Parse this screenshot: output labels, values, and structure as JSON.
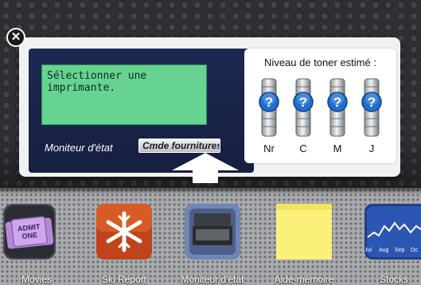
{
  "widget": {
    "lcd_text": "Sélectionner une\nimprimante.",
    "status_label": "Moniteur d'état",
    "supply_button_label": "Cmde fournitures",
    "toner": {
      "title": "Niveau de toner estimé :",
      "cartridges": [
        {
          "label": "Nr",
          "status": "unknown"
        },
        {
          "label": "C",
          "status": "unknown"
        },
        {
          "label": "M",
          "status": "unknown"
        },
        {
          "label": "J",
          "status": "unknown"
        }
      ],
      "unknown_glyph": "?"
    },
    "close_glyph": "✕"
  },
  "dock": {
    "apps": [
      {
        "name": "Movies",
        "icon": "movie-ticket-icon",
        "ticket_text": "ADMIT ONE"
      },
      {
        "name": "Ski Report",
        "icon": "snowflake-icon"
      },
      {
        "name": "Moniteur d'état",
        "icon": "printer-icon"
      },
      {
        "name": "Aide-mémoire",
        "icon": "sticky-note-icon"
      },
      {
        "name": "Stocks",
        "icon": "stock-chart-icon",
        "chart_labels": [
          "Jul",
          "Aug",
          "Sep",
          "Oc"
        ]
      }
    ]
  },
  "colors": {
    "lcd": "#66d391",
    "panel": "#1d2952",
    "accent_blue": "#2f8be8",
    "toner_badge": "#1e6fd1"
  }
}
